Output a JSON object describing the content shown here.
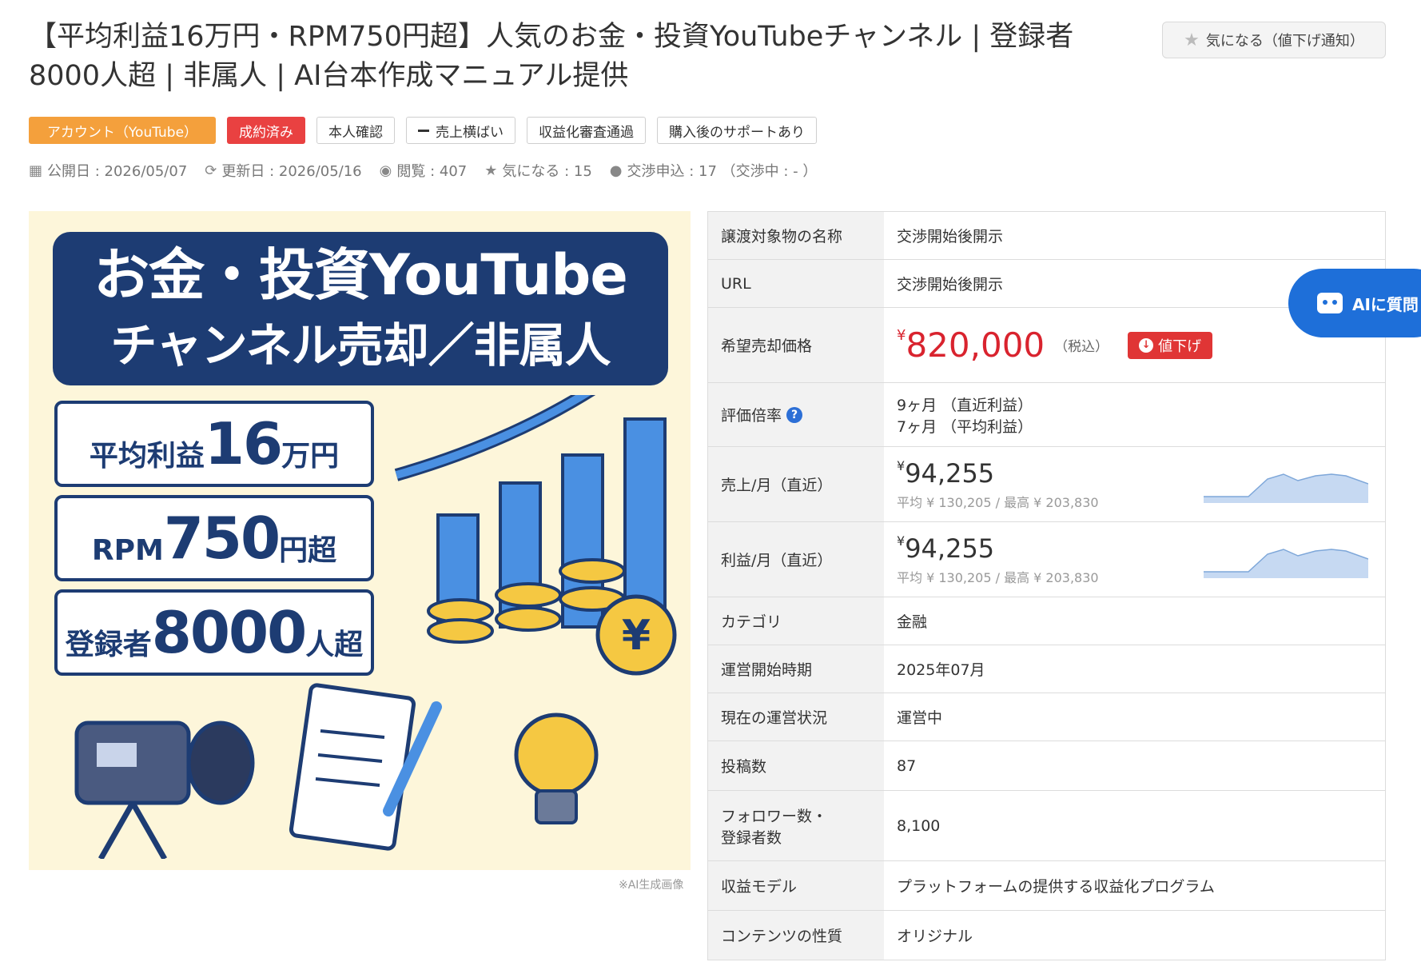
{
  "title": "【平均利益16万円・RPM750円超】人気のお金・投資YouTubeチャンネル | 登録者8000人超 | 非属人 | AI台本作成マニュアル提供",
  "watch_button": "気になる（値下げ通知）",
  "tags": [
    {
      "label": "アカウント（YouTube）",
      "style": "orange"
    },
    {
      "label": "成約済み",
      "style": "red"
    },
    {
      "label": "本人確認",
      "style": "plain"
    },
    {
      "label": "売上横ばい",
      "style": "plain-dash"
    },
    {
      "label": "収益化審査通過",
      "style": "plain"
    },
    {
      "label": "購入後のサポートあり",
      "style": "plain"
    }
  ],
  "meta": {
    "published": "公開日 : 2026/05/07",
    "updated": "更新日 : 2026/05/16",
    "views": "閲覧 : 407",
    "likes": "気になる : 15",
    "negotiations": "交渉申込 : 17 （交渉中 : - ）"
  },
  "banner": {
    "line1": "お金・投資YouTube",
    "line2": "チャンネル売却／非属人",
    "stat1": {
      "pre": "平均利益",
      "big": "16",
      "post": "万円"
    },
    "stat2": {
      "pre": "RPM",
      "big": "750",
      "post": "円超"
    },
    "stat3": {
      "pre": "登録者",
      "big": "8000",
      "post": "人超"
    },
    "coin_symbol": "¥",
    "note": "※AI生成画像"
  },
  "spec": {
    "name": {
      "k": "譲渡対象物の名称",
      "v": "交渉開始後開示"
    },
    "url": {
      "k": "URL",
      "v": "交渉開始後開示"
    },
    "price": {
      "k": "希望売却価格",
      "yen": "¥",
      "v": "820,000",
      "tax": "（税込）",
      "down": "値下げ"
    },
    "multiple": {
      "k": "評価倍率",
      "v1": "9ヶ月 （直近利益）",
      "v2": "7ヶ月 （平均利益）"
    },
    "sales": {
      "k": "売上/月（直近）",
      "yen": "¥",
      "v": "94,255",
      "sub": "平均 ¥ 130,205 / 最高 ¥ 203,830"
    },
    "profit": {
      "k": "利益/月（直近）",
      "yen": "¥",
      "v": "94,255",
      "sub": "平均 ¥ 130,205 / 最高 ¥ 203,830"
    },
    "category": {
      "k": "カテゴリ",
      "v": "金融"
    },
    "start": {
      "k": "運営開始時期",
      "v": "2025年07月"
    },
    "status": {
      "k": "現在の運営状況",
      "v": "運営中"
    },
    "posts": {
      "k": "投稿数",
      "v": "87"
    },
    "followers": {
      "k1": "フォロワー数・",
      "k2": "登録者数",
      "v": "8,100"
    },
    "model": {
      "k": "収益モデル",
      "v": "プラットフォームの提供する収益化プログラム"
    },
    "content": {
      "k": "コンテンツの性質",
      "v": "オリジナル"
    }
  },
  "ai_fab": "AIに質問",
  "colors": {
    "accent": "#1e6fd9",
    "price": "#d9232e",
    "navy": "#1d3c73",
    "orange": "#f4a03c"
  }
}
